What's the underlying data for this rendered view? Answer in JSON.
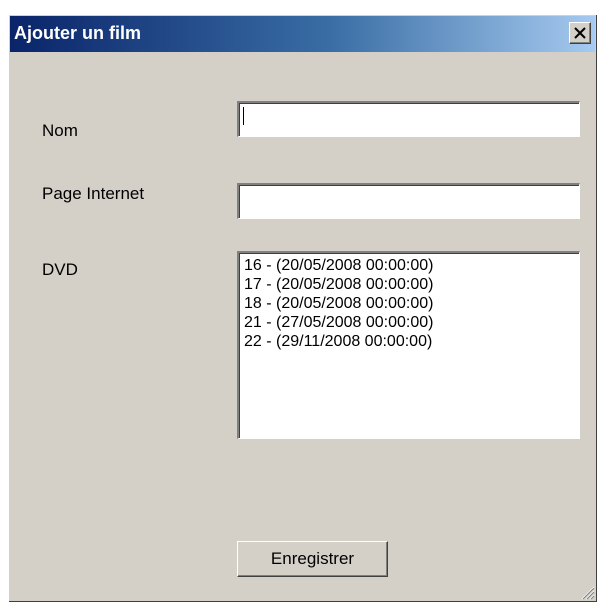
{
  "window": {
    "title": "Ajouter un film"
  },
  "form": {
    "nom_label": "Nom",
    "nom_value": "",
    "page_label": "Page Internet",
    "page_value": "",
    "dvd_label": "DVD",
    "dvd_items": [
      "16 - (20/05/2008 00:00:00)",
      "17 - (20/05/2008 00:00:00)",
      "18 - (20/05/2008 00:00:00)",
      "21 - (27/05/2008 00:00:00)",
      "22 - (29/11/2008 00:00:00)"
    ],
    "save_label": "Enregistrer"
  },
  "icons": {
    "close": "close-icon",
    "grip": "resize-grip-icon"
  },
  "colors": {
    "titlebar_start": "#0a246a",
    "titlebar_end": "#a6caf0",
    "face": "#d4d0c8"
  }
}
